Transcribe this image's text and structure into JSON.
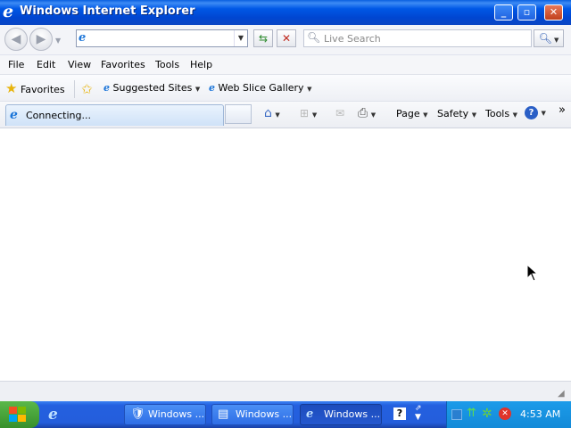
{
  "window": {
    "title": "Windows Internet Explorer"
  },
  "address": {
    "value": ""
  },
  "search": {
    "placeholder": "Live Search"
  },
  "menu": [
    "File",
    "Edit",
    "View",
    "Favorites",
    "Tools",
    "Help"
  ],
  "favorites_bar": {
    "favorites_label": "Favorites",
    "suggested_sites": "Suggested Sites",
    "web_slice_gallery": "Web Slice Gallery"
  },
  "tab": {
    "label": "Connecting..."
  },
  "command_bar": {
    "page": "Page",
    "safety": "Safety",
    "tools": "Tools"
  },
  "taskbar": {
    "buttons": [
      "Windows ...",
      "Windows ...",
      "Windows ..."
    ],
    "clock": "4:53 AM"
  }
}
